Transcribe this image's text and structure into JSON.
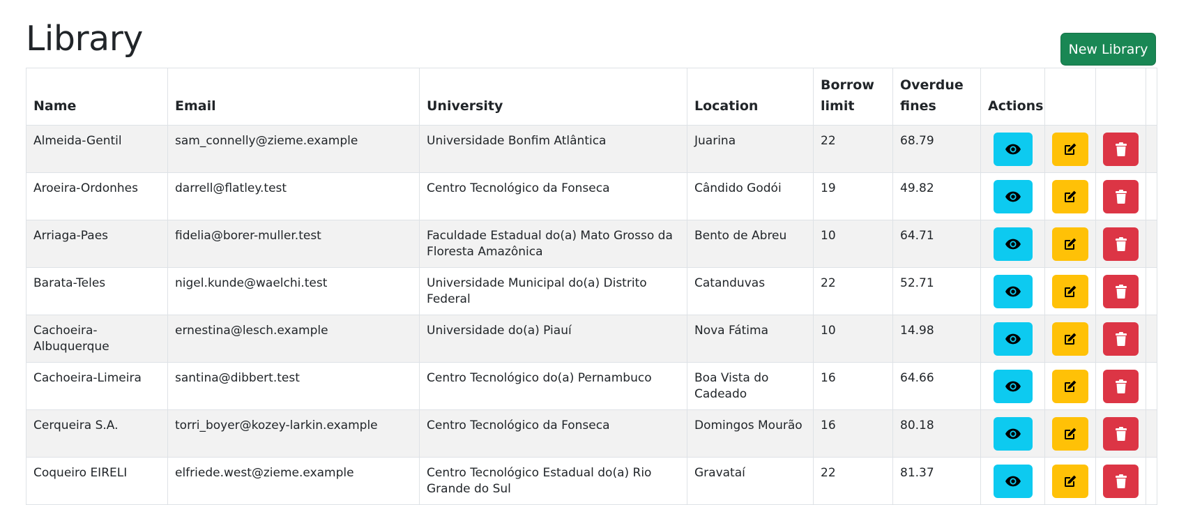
{
  "page": {
    "title": "Library",
    "new_button_label": "New Library"
  },
  "table": {
    "headers": {
      "name": "Name",
      "email": "Email",
      "university": "University",
      "location": "Location",
      "borrow_limit": "Borrow limit",
      "overdue_fines": "Overdue fines",
      "actions": "Actions"
    },
    "rows": [
      {
        "name": "Almeida-Gentil",
        "email": "sam_connelly@zieme.example",
        "university": "Universidade Bonfim Atlântica",
        "location": "Juarina",
        "borrow_limit": "22",
        "overdue_fines": "68.79"
      },
      {
        "name": "Aroeira-Ordonhes",
        "email": "darrell@flatley.test",
        "university": "Centro Tecnológico da Fonseca",
        "location": "Cândido Godói",
        "borrow_limit": "19",
        "overdue_fines": "49.82"
      },
      {
        "name": "Arriaga-Paes",
        "email": "fidelia@borer-muller.test",
        "university": "Faculdade Estadual do(a) Mato Grosso da Floresta Amazônica",
        "location": "Bento de Abreu",
        "borrow_limit": "10",
        "overdue_fines": "64.71"
      },
      {
        "name": "Barata-Teles",
        "email": "nigel.kunde@waelchi.test",
        "university": "Universidade Municipal do(a) Distrito Federal",
        "location": "Catanduvas",
        "borrow_limit": "22",
        "overdue_fines": "52.71"
      },
      {
        "name": "Cachoeira-Albuquerque",
        "email": "ernestina@lesch.example",
        "university": "Universidade do(a) Piauí",
        "location": "Nova Fátima",
        "borrow_limit": "10",
        "overdue_fines": "14.98"
      },
      {
        "name": "Cachoeira-Limeira",
        "email": "santina@dibbert.test",
        "university": "Centro Tecnológico do(a) Pernambuco",
        "location": "Boa Vista do Cadeado",
        "borrow_limit": "16",
        "overdue_fines": "64.66"
      },
      {
        "name": "Cerqueira S.A.",
        "email": "torri_boyer@kozey-larkin.example",
        "university": "Centro Tecnológico da Fonseca",
        "location": "Domingos Mourão",
        "borrow_limit": "16",
        "overdue_fines": "80.18"
      },
      {
        "name": "Coqueiro EIRELI",
        "email": "elfriede.west@zieme.example",
        "university": "Centro Tecnológico Estadual do(a) Rio Grande do Sul",
        "location": "Gravataí",
        "borrow_limit": "22",
        "overdue_fines": "81.37"
      }
    ],
    "row_actions": [
      {
        "name": "view-button",
        "icon": "eye-icon",
        "color": "#0dcaf0"
      },
      {
        "name": "edit-button",
        "icon": "edit-icon",
        "color": "#ffc107"
      },
      {
        "name": "delete-button",
        "icon": "trash-icon",
        "color": "#dc3545"
      }
    ]
  },
  "colors": {
    "primary_action": "#198754",
    "view": "#0dcaf0",
    "edit": "#ffc107",
    "delete": "#dc3545",
    "stripe": "#f2f2f2"
  }
}
